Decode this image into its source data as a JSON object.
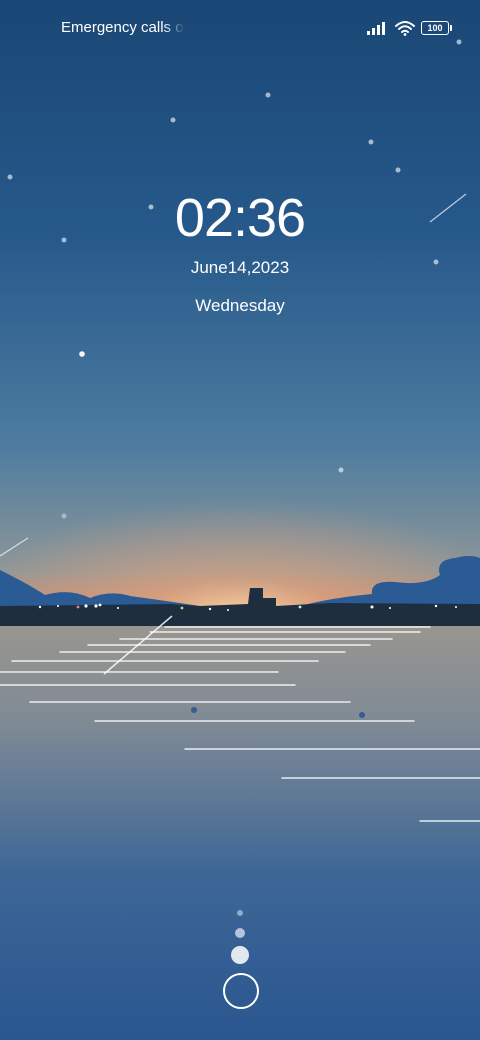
{
  "status_bar": {
    "carrier_text": "Emergency calls o",
    "battery_level": "100",
    "signal_icon": "cellular-signal-icon",
    "wifi_icon": "wifi-icon"
  },
  "lock_screen": {
    "time": "02:36",
    "date": "June14,2023",
    "weekday": "Wednesday"
  },
  "unlock_control": {
    "icon": "unlock-ring-icon"
  },
  "wallpaper": {
    "sky_top_color": "#1a4775",
    "horizon_glow_color": "#e58b62",
    "sea_color": "#2a5690"
  }
}
